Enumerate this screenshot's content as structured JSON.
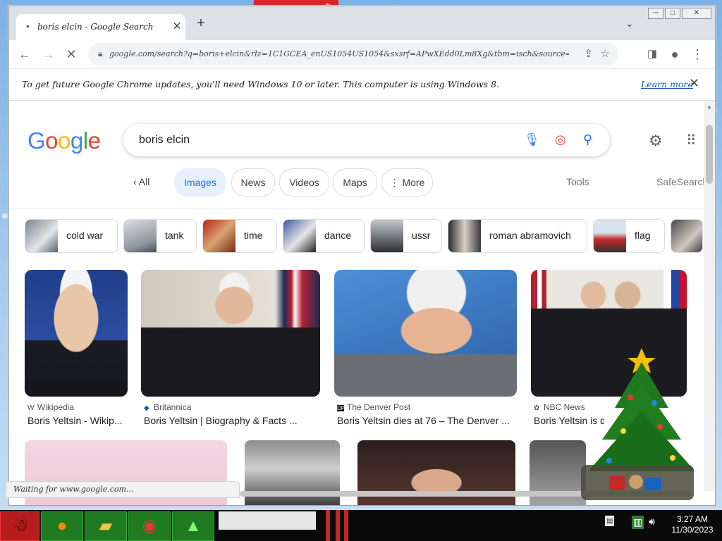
{
  "browser": {
    "tab_title": "boris elcin - Google Search",
    "new_tab": "+",
    "url": "google.com/search?q=boris+elcin&rlz=1C1GCEA_enUS1054US1054&sxsrf=APwXEdd0Lm8Xg&tbm=isch&source=lnms",
    "window_controls": [
      "─",
      "□",
      "✕"
    ]
  },
  "infobar": {
    "message": "To get future Google Chrome updates, you'll need Windows 10 or later. This computer is using Windows 8.",
    "learn_more": "Learn more"
  },
  "search": {
    "query": "boris elcin",
    "logo": [
      "G",
      "o",
      "o",
      "g",
      "l",
      "e"
    ],
    "logo_colors": [
      "#4285F4",
      "#EA4335",
      "#FBBC05",
      "#4285F4",
      "#34A853",
      "#EA4335"
    ]
  },
  "nav": {
    "all": "All",
    "tabs": [
      "Images",
      "News",
      "Videos",
      "Maps",
      "More"
    ],
    "tools": "Tools",
    "safesearch": "SafeSearch"
  },
  "related": [
    "cold war",
    "tank",
    "time",
    "dance",
    "ussr",
    "roman abramovich",
    "flag"
  ],
  "results": [
    {
      "source": "Wikipedia",
      "title": "Boris Yeltsin - Wikip..."
    },
    {
      "source": "Britannica",
      "title": "Boris Yeltsin | Biography & Facts ..."
    },
    {
      "source": "The Denver Post",
      "title": "Boris Yeltsin dies at 76 – The Denver ..."
    },
    {
      "source": "NBC News",
      "title": "Boris Yeltsin is de..."
    }
  ],
  "status": "Waiting for www.google.com...",
  "taskbar": {
    "time": "3:27 AM",
    "date": "11/30/2023"
  }
}
